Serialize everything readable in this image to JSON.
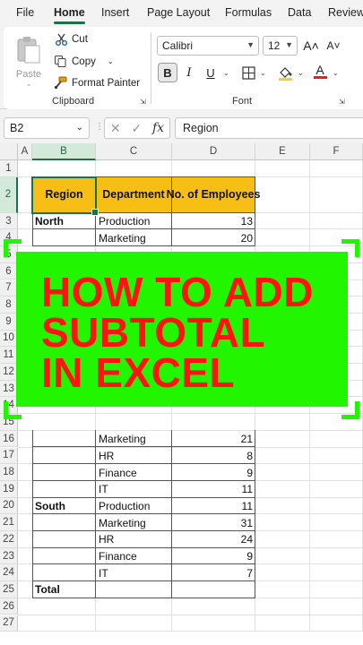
{
  "ribbon": {
    "tabs": [
      "File",
      "Home",
      "Insert",
      "Page Layout",
      "Formulas",
      "Data",
      "Review"
    ],
    "active_tab": "Home",
    "clipboard": {
      "paste_label": "Paste",
      "cut_label": "Cut",
      "copy_label": "Copy",
      "format_painter_label": "Format Painter",
      "group_label": "Clipboard"
    },
    "font": {
      "font_name": "Calibri",
      "font_size": "12",
      "grow_label": "A˄",
      "shrink_label": "A˅",
      "bold_label": "B",
      "italic_label": "I",
      "underline_label": "U",
      "font_color_label": "A",
      "group_label": "Font"
    }
  },
  "formula_bar": {
    "name_box": "B2",
    "cancel_glyph": "✕",
    "enter_glyph": "✓",
    "fx_label": "fx",
    "formula": "Region"
  },
  "grid": {
    "columns": [
      "A",
      "B",
      "C",
      "D",
      "E",
      "F"
    ],
    "rows": [
      "1",
      "2",
      "3",
      "4",
      "5",
      "6",
      "7",
      "8",
      "9",
      "10",
      "11",
      "12",
      "13",
      "14",
      "15",
      "16",
      "17",
      "18",
      "19",
      "20",
      "21",
      "22",
      "23",
      "24",
      "25",
      "26",
      "27"
    ],
    "selected_cell": "B2",
    "table": {
      "headers": [
        "Region",
        "Department",
        "No. of Employees"
      ],
      "rows": [
        {
          "region": "North",
          "department": "Production",
          "employees": "13"
        },
        {
          "region": "",
          "department": "Marketing",
          "employees": "20"
        },
        {
          "region": "",
          "department": "Marketing",
          "employees": "21"
        },
        {
          "region": "",
          "department": "HR",
          "employees": "8"
        },
        {
          "region": "",
          "department": "Finance",
          "employees": "9"
        },
        {
          "region": "",
          "department": "IT",
          "employees": "11"
        },
        {
          "region": "South",
          "department": "Production",
          "employees": "11"
        },
        {
          "region": "",
          "department": "Marketing",
          "employees": "31"
        },
        {
          "region": "",
          "department": "HR",
          "employees": "24"
        },
        {
          "region": "",
          "department": "Finance",
          "employees": "9"
        },
        {
          "region": "",
          "department": "IT",
          "employees": "7"
        },
        {
          "region": "Total",
          "department": "",
          "employees": ""
        }
      ]
    }
  },
  "overlay": {
    "lines": [
      "HOW TO ADD",
      "SUBTOTAL",
      "IN EXCEL"
    ],
    "background_color": "#22f500",
    "text_color": "#ff1414"
  }
}
